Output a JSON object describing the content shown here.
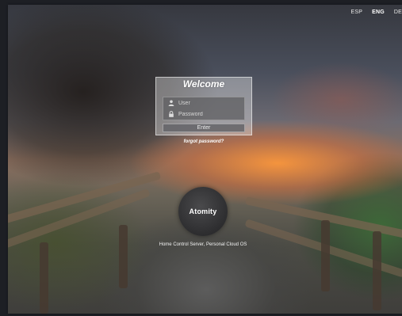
{
  "languages": [
    {
      "label": "ESP",
      "active": false
    },
    {
      "label": "ENG",
      "active": true
    },
    {
      "label": "DE",
      "active": false
    }
  ],
  "login": {
    "title": "Welcome",
    "user_placeholder": "User",
    "password_placeholder": "Password",
    "enter_label": "Enter",
    "forgot_label": "forgot password?"
  },
  "brand": {
    "logo_text": "Atomity",
    "tagline": "Home Control Server, Personal Cloud OS"
  },
  "icons": {
    "user": "user-icon",
    "password": "lock-icon"
  }
}
